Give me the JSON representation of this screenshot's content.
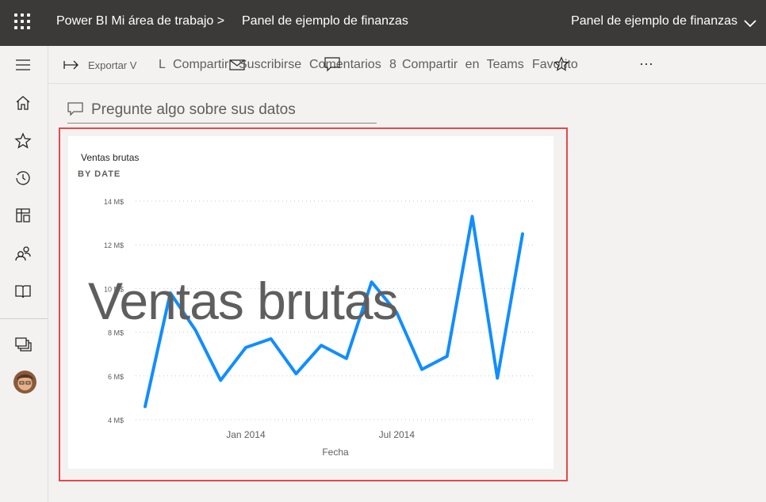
{
  "topbar": {
    "breadcrumb_workspace": "Power BI Mi área de trabajo >",
    "breadcrumb_dashboard": "Panel de ejemplo de finanzas",
    "dashboard_selector": "Panel de ejemplo de finanzas",
    "icons": [
      "app-launcher-icon",
      "chevron-down-icon"
    ]
  },
  "leftnav": {
    "icons": [
      "hamburger-icon",
      "home-icon",
      "star-icon",
      "clock-icon",
      "apps-icon",
      "people-icon",
      "book-icon",
      "workspaces-icon"
    ]
  },
  "actionbar": {
    "export": "Exportar V",
    "share_l": "L",
    "share": "Compartir",
    "subscribe": "Suscribirse",
    "comments": "Comentarios",
    "comments_count": "8",
    "share_teams": "Compartir en Teams",
    "favorite": "Favorito",
    "more": "···"
  },
  "qa": {
    "placeholder": "Pregunte algo sobre sus datos"
  },
  "tile": {
    "title": "Ventas brutas",
    "subtitle": "BY DATE",
    "overlay_text": "Ventas brutas"
  },
  "chart_data": {
    "type": "line",
    "title": "Ventas brutas",
    "subtitle": "BY DATE",
    "xlabel": "Fecha",
    "ylabel": "",
    "ylim": [
      4,
      14
    ],
    "y_ticks": [
      "4 M$",
      "6 M$",
      "8 M$",
      "10 M$",
      "12 M$",
      "14 M$"
    ],
    "x_ticks": [
      "Jan 2014",
      "Jul 2014"
    ],
    "grid": true,
    "color": "#118dff",
    "x": [
      "2013-09",
      "2013-10",
      "2013-11",
      "2013-12",
      "2014-01",
      "2014-02",
      "2014-03",
      "2014-04",
      "2014-05",
      "2014-06",
      "2014-07",
      "2014-08",
      "2014-09",
      "2014-10",
      "2014-11",
      "2014-12"
    ],
    "values": [
      4.6,
      9.8,
      8.1,
      5.8,
      7.3,
      7.7,
      6.1,
      7.4,
      6.8,
      10.3,
      8.9,
      6.3,
      6.9,
      13.3,
      5.9,
      12.5
    ]
  }
}
